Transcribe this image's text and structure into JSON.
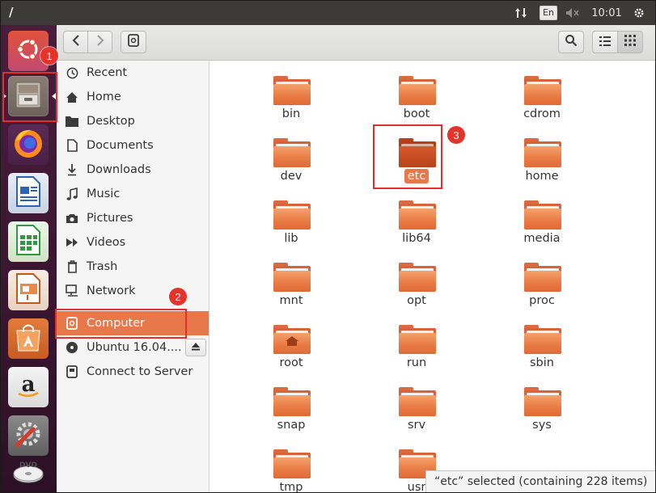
{
  "window": {
    "title": "/"
  },
  "top_panel": {
    "language": "En",
    "time": "10:01"
  },
  "launcher": {
    "items": [
      {
        "name": "ubuntu-dash",
        "icon": "ubuntu-logo-icon"
      },
      {
        "name": "files",
        "icon": "file-cabinet-icon",
        "active": true
      },
      {
        "name": "firefox",
        "icon": "firefox-icon"
      },
      {
        "name": "writer",
        "icon": "writer-document-icon"
      },
      {
        "name": "calc",
        "icon": "calc-spreadsheet-icon"
      },
      {
        "name": "impress",
        "icon": "impress-presentation-icon"
      },
      {
        "name": "software",
        "icon": "shopping-bag-icon"
      },
      {
        "name": "amazon",
        "icon": "amazon-icon"
      },
      {
        "name": "settings",
        "icon": "wrench-gear-icon"
      },
      {
        "name": "dvd",
        "icon": "dvd-icon"
      }
    ]
  },
  "sidebar": {
    "items": [
      {
        "label": "Recent",
        "icon": "clock-icon"
      },
      {
        "label": "Home",
        "icon": "home-icon"
      },
      {
        "label": "Desktop",
        "icon": "folder-icon"
      },
      {
        "label": "Documents",
        "icon": "document-icon"
      },
      {
        "label": "Downloads",
        "icon": "download-icon"
      },
      {
        "label": "Music",
        "icon": "music-note-icon"
      },
      {
        "label": "Pictures",
        "icon": "camera-icon"
      },
      {
        "label": "Videos",
        "icon": "video-icon"
      },
      {
        "label": "Trash",
        "icon": "trash-icon"
      },
      {
        "label": "Network",
        "icon": "network-icon"
      },
      {
        "label": "Computer",
        "icon": "computer-icon",
        "selected": true
      },
      {
        "label": "Ubuntu 16.04....",
        "icon": "disc-icon"
      },
      {
        "label": "Connect to Server",
        "icon": "server-icon"
      }
    ]
  },
  "files": [
    {
      "name": "bin"
    },
    {
      "name": "boot"
    },
    {
      "name": "cdrom"
    },
    {
      "name": "dev"
    },
    {
      "name": "etc",
      "selected": true
    },
    {
      "name": "home"
    },
    {
      "name": "lib"
    },
    {
      "name": "lib64"
    },
    {
      "name": "media"
    },
    {
      "name": "mnt"
    },
    {
      "name": "opt"
    },
    {
      "name": "proc"
    },
    {
      "name": "root",
      "emblem": "home-emblem-icon"
    },
    {
      "name": "run"
    },
    {
      "name": "sbin"
    },
    {
      "name": "snap"
    },
    {
      "name": "srv"
    },
    {
      "name": "sys"
    },
    {
      "name": "tmp"
    },
    {
      "name": "usr"
    }
  ],
  "status": {
    "text": "“etc” selected  (containing 228 items)"
  },
  "annotations": {
    "badge_1": "1",
    "badge_2": "2",
    "badge_3": "3"
  },
  "colors": {
    "accent": "#e8784a",
    "annotation": "#e0302f",
    "launcher": "#3a1630",
    "panel": "#3c3b37"
  }
}
